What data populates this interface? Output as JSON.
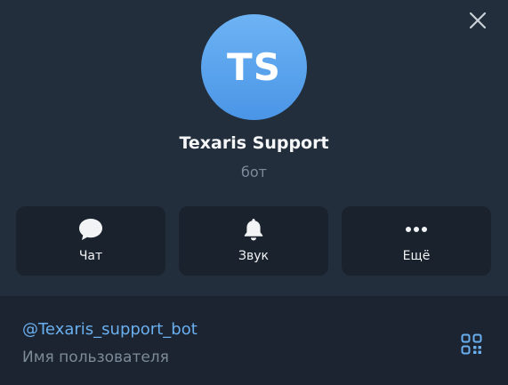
{
  "profile": {
    "avatar_initials": "TS",
    "name": "Texaris Support",
    "subtitle": "бот"
  },
  "actions": [
    {
      "label": "Чат",
      "icon": "chat-bubble-icon"
    },
    {
      "label": "Звук",
      "icon": "bell-icon"
    },
    {
      "label": "Ещё",
      "icon": "more-dots-icon"
    }
  ],
  "info": {
    "username": "@Texaris_support_bot",
    "username_label": "Имя пользователя"
  },
  "icons": {
    "close": "close-icon",
    "qr": "qr-code-icon"
  },
  "colors": {
    "background": "#232e3c",
    "card": "#1a222d",
    "accent": "#6aafef",
    "avatar_top": "#6db3f4",
    "avatar_bottom": "#4a95e6",
    "muted_text": "#7c8a99"
  }
}
